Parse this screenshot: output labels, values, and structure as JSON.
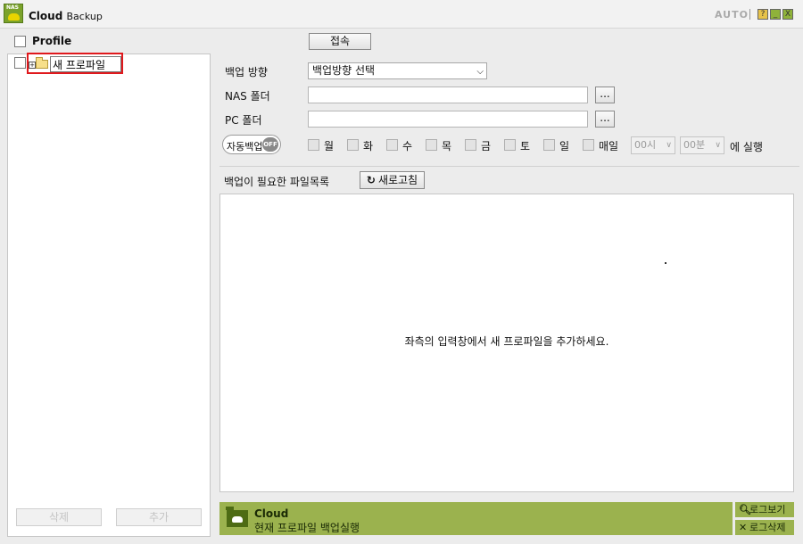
{
  "titlebar": {
    "title": "Cloud",
    "subtitle": "Backup",
    "logo_text": "NAS",
    "auto_label": "AUTO",
    "help_symbol": "?",
    "min_symbol": "_",
    "close_symbol": "X"
  },
  "left": {
    "profile_header": "Profile",
    "tree": [
      {
        "name": "새 프로파일",
        "expand_symbol": "+"
      }
    ],
    "delete_label": "삭제",
    "add_label": "추가"
  },
  "form": {
    "connect_label": "접속",
    "direction_label": "백업 방향",
    "direction_value": "백업방향 선택",
    "nas_label": "NAS 폴더",
    "nas_value": "",
    "pc_label": "PC 폴더",
    "pc_value": "",
    "browse_label": "...",
    "auto_backup_label": "자동백업",
    "auto_backup_state": "OFF",
    "days": [
      "월",
      "화",
      "수",
      "목",
      "금",
      "토",
      "일",
      "매일"
    ],
    "hour_value": "00시",
    "minute_value": "00분",
    "run_suffix": "에 실행"
  },
  "files": {
    "header": "백업이 필요한 파일목록",
    "refresh_label": "새로고침",
    "refresh_icon": "refresh-icon",
    "empty_message": "좌측의 입력창에서 새 프로파일을 추가하세요."
  },
  "status": {
    "title": "Cloud",
    "subtitle": "현재 프로파일 백업실행",
    "view_log_label": "로그보기",
    "delete_log_label": "로그삭제"
  },
  "colors": {
    "accent_green": "#9bb24e",
    "dark_green": "#4d6b14",
    "highlight_red": "#e0191d"
  }
}
